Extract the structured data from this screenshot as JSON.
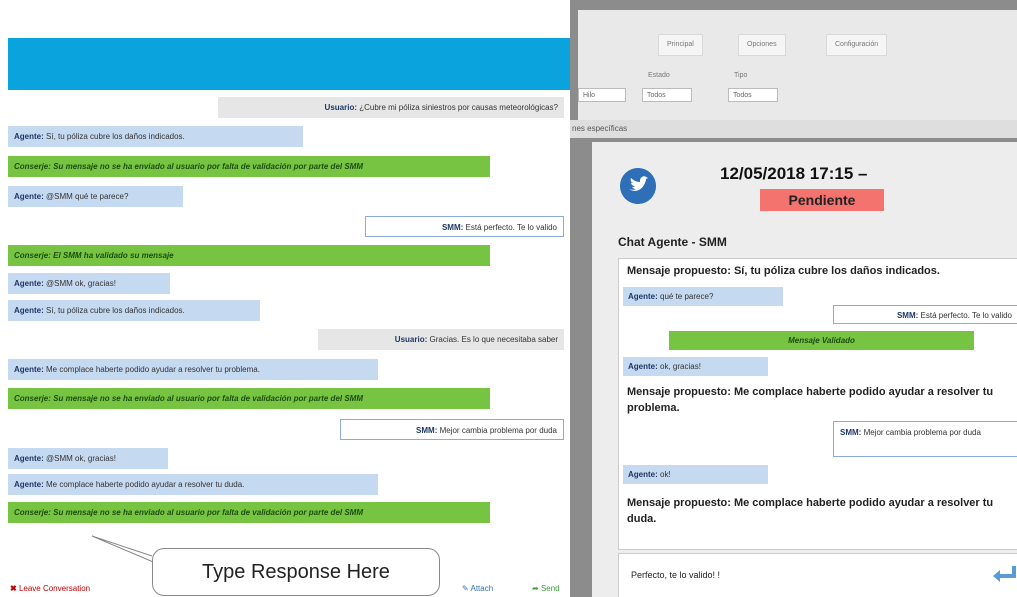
{
  "left_chat": {
    "messages": [
      {
        "type": "user",
        "speaker": "Usuario:",
        "text": "¿Cubre mi póliza siniestros por causas meteorológicas?"
      },
      {
        "type": "agent",
        "speaker": "Agente:",
        "text": "Sí, tu póliza cubre los daños indicados."
      },
      {
        "type": "conserje",
        "speaker": "Conserje:",
        "text": "Su mensaje no se ha enviado al usuario por falta de validación por parte del SMM"
      },
      {
        "type": "agent",
        "speaker": "Agente:",
        "text": "@SMM qué te parece?"
      },
      {
        "type": "smm",
        "speaker": "SMM:",
        "text": "Está perfecto. Te lo valido"
      },
      {
        "type": "conserje",
        "speaker": "Conserje:",
        "text": "El SMM ha validado su mensaje"
      },
      {
        "type": "agent",
        "speaker": "Agente:",
        "text": "@SMM ok, gracias!"
      },
      {
        "type": "agent",
        "speaker": "Agente:",
        "text": "Sí, tu póliza cubre los daños indicados."
      },
      {
        "type": "user",
        "speaker": "Usuario:",
        "text": "Gracias. Es lo que necesitaba saber"
      },
      {
        "type": "agent",
        "speaker": "Agente:",
        "text": "Me complace haberte podido ayudar a resolver tu problema."
      },
      {
        "type": "conserje",
        "speaker": "Conserje:",
        "text": "Su mensaje no se ha enviado al usuario por falta de validación por parte del SMM"
      },
      {
        "type": "smm",
        "speaker": "SMM:",
        "text": "Mejor cambia problema por duda"
      },
      {
        "type": "agent",
        "speaker": "Agente:",
        "text": "@SMM ok, gracias!"
      },
      {
        "type": "agent",
        "speaker": "Agente:",
        "text": "Me complace haberte podido ayudar a resolver tu duda."
      },
      {
        "type": "conserje",
        "speaker": "Conserje:",
        "text": "Su mensaje no se ha enviado al usuario por falta de validación por parte del SMM"
      }
    ],
    "callout": "Type Response Here",
    "leave": "Leave Conversation",
    "attach": "Attach",
    "send": "Send"
  },
  "ribbon": {
    "tabs": [
      "Principal",
      "Opciones",
      "Configuración"
    ],
    "field1_label": "Estado",
    "field2_label": "Tipo",
    "drop0": "Hilo",
    "drop1": "Todos",
    "drop2": "Todos",
    "strip": "nes específicas"
  },
  "panel": {
    "datetime": "12/05/2018 17:15 –",
    "status": "Pendiente",
    "status_color": "#f4736f",
    "chat_title": "Chat Agente - SMM",
    "prop1": "Mensaje propuesto: Sí, tu póliza cubre los daños indicados.",
    "agent1_speaker": "Agente:",
    "agent1_text": "qué te parece?",
    "smm1_speaker": "SMM:",
    "smm1_text": "Está perfecto. Te lo valido",
    "validated": "Mensaje Validado",
    "agent2_speaker": "Agente:",
    "agent2_text": "ok, gracias!",
    "prop2": "Mensaje propuesto: Me complace haberte podido ayudar a resolver tu problema.",
    "smm2_speaker": "SMM:",
    "smm2_text": "Mejor cambia problema por duda",
    "agent3_speaker": "Agente:",
    "agent3_text": "ok!",
    "prop3": "Mensaje propuesto: Me complace haberte podido ayudar a resolver tu duda.",
    "reply": "Perfecto, te lo valido! !"
  },
  "colors": {
    "header_blue": "#0aa3de",
    "agent_bg": "#c5d9f1",
    "conserje_bg": "#76c442",
    "user_bg": "#e7e6e6"
  },
  "icons": [
    "twitter-bird-icon",
    "send-arrow-icon",
    "close-x-icon",
    "attach-icon",
    "send-icon"
  ]
}
